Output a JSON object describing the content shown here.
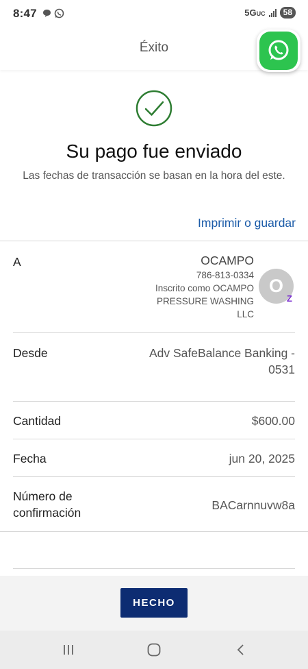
{
  "status_bar": {
    "time": "8:47",
    "network": "5G",
    "network_suffix": "UC",
    "battery": "58"
  },
  "header": {
    "title": "Éxito"
  },
  "success": {
    "title": "Su pago fue enviado",
    "subtitle": "Las fechas de transacción se basan en la hora del este.",
    "print_link": "Imprimir o guardar"
  },
  "details": {
    "to": {
      "label": "A",
      "name": "OCAMPO",
      "phone": "786-813-0334",
      "enrolled_as": "Inscrito como OCAMPO",
      "business_line1": "PRESSURE WASHING",
      "business_line2": "LLC",
      "avatar_letter": "O",
      "badge": "Z"
    },
    "from": {
      "label": "Desde",
      "value_line1": "Adv SafeBalance Banking -",
      "value_line2": "0531"
    },
    "amount": {
      "label": "Cantidad",
      "value": "$600.00"
    },
    "date": {
      "label": "Fecha",
      "value": "jun 20, 2025"
    },
    "confirmation": {
      "label_line1": "Número de",
      "label_line2": "confirmación",
      "value": "BACarnnuvw8a"
    }
  },
  "actions": {
    "done": "HECHO"
  },
  "colors": {
    "success_green": "#2e7d32",
    "link_blue": "#1b5ba8",
    "button_navy": "#0d2c72",
    "whatsapp_green": "#2dc44f",
    "zelle_purple": "#7b2fcf"
  },
  "icons": {
    "success": "check-circle-icon",
    "floating": "whatsapp-icon",
    "nav": [
      "recents-icon",
      "home-icon",
      "back-icon"
    ]
  }
}
